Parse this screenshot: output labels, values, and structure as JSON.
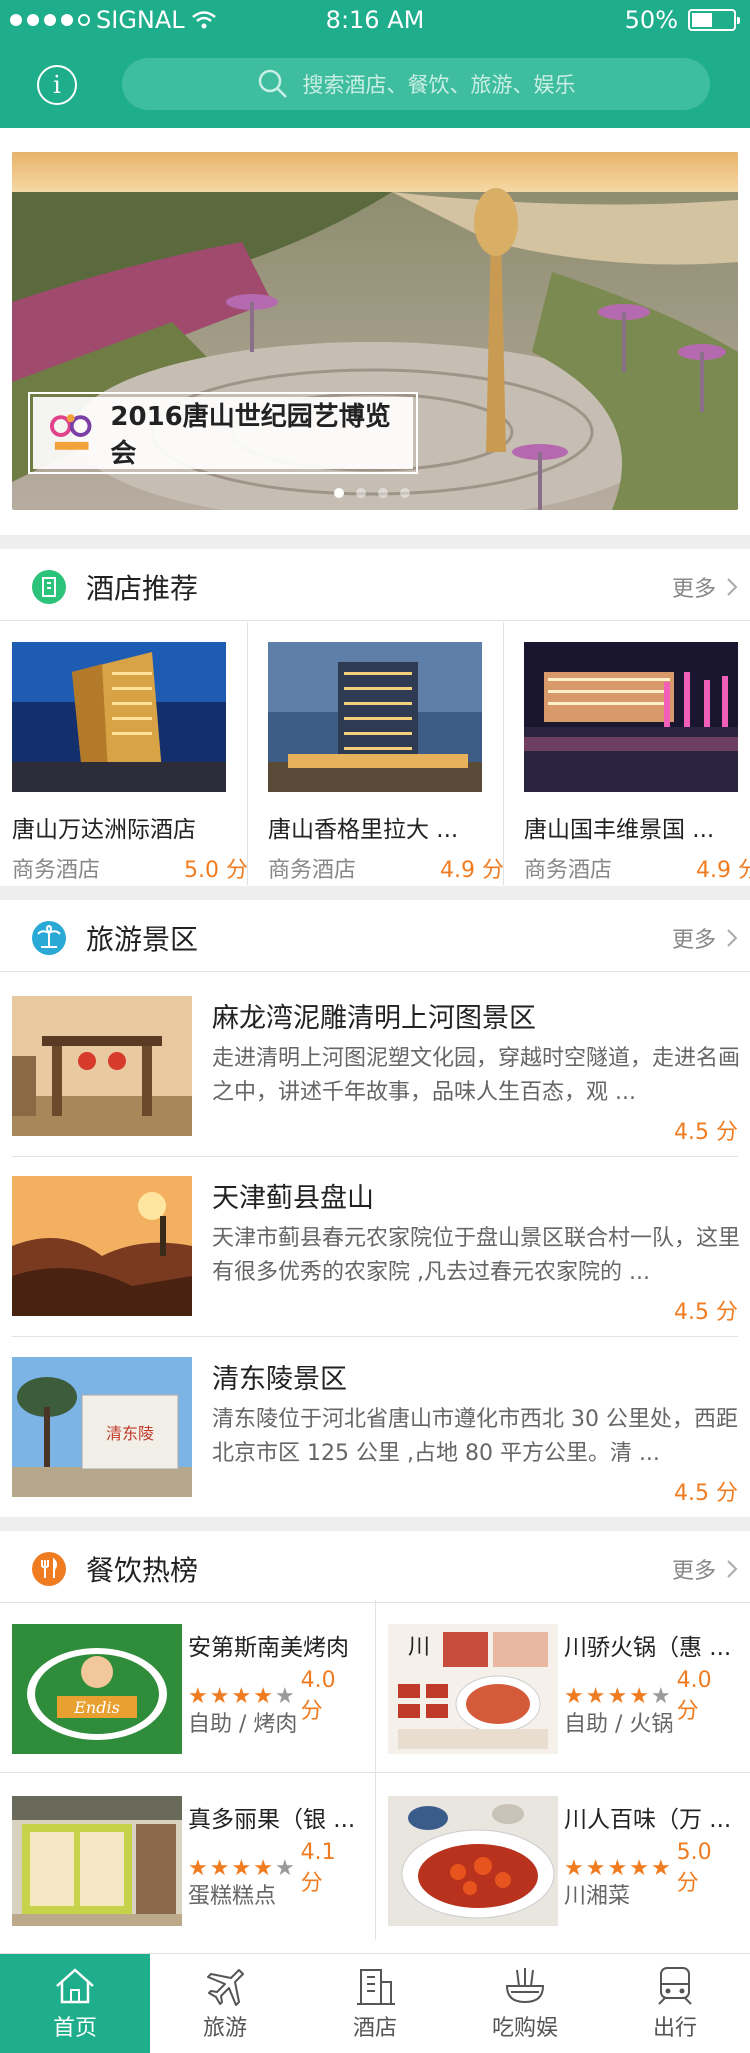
{
  "status": {
    "carrier": "SIGNAL",
    "time": "8:16 AM",
    "battery": "50%"
  },
  "header": {
    "search_placeholder": "搜索酒店、餐饮、旅游、娱乐"
  },
  "banner": {
    "caption": "2016唐山世纪园艺博览会",
    "pages": 4,
    "active_page": 0
  },
  "hotels": {
    "title": "酒店推荐",
    "more": "更多",
    "items": [
      {
        "name": "唐山万达洲际酒店",
        "type": "商务酒店",
        "score": "5.0 分"
      },
      {
        "name": "唐山香格里拉大 ...",
        "type": "商务酒店",
        "score": "4.9 分"
      },
      {
        "name": "唐山国丰维景国 ...",
        "type": "商务酒店",
        "score": "4.9 分"
      }
    ]
  },
  "tourism": {
    "title": "旅游景区",
    "more": "更多",
    "items": [
      {
        "name": "麻龙湾泥雕清明上河图景区",
        "desc": "走进清明上河图泥塑文化园，穿越时空隧道，走进名画之中，讲述千年故事，品味人生百态，观 ...",
        "score": "4.5 分"
      },
      {
        "name": "天津蓟县盘山",
        "desc": "天津市蓟县春元农家院位于盘山景区联合村一队，这里有很多优秀的农家院 ,凡去过春元农家院的 ...",
        "score": "4.5 分"
      },
      {
        "name": "清东陵景区",
        "desc": "清东陵位于河北省唐山市遵化市西北 30 公里处，西距北京市区 125 公里 ,占地 80 平方公里。清 ...",
        "score": "4.5 分"
      }
    ]
  },
  "food": {
    "title": "餐饮热榜",
    "more": "更多",
    "items": [
      {
        "name": "安第斯南美烤肉",
        "rating": 4.0,
        "score": "4.0 分",
        "category": "自助 / 烤肉"
      },
      {
        "name": "川骄火锅（惠 ...",
        "rating": 4.0,
        "score": "4.0 分",
        "category": "自助 / 火锅"
      },
      {
        "name": "真多丽果（银 ...",
        "rating": 4.1,
        "score": "4.1 分",
        "category": "蛋糕糕点"
      },
      {
        "name": "川人百味（万 ...",
        "rating": 5.0,
        "score": "5.0 分",
        "category": "川湘菜"
      }
    ]
  },
  "tabbar": {
    "items": [
      {
        "label": "首页",
        "icon": "home-icon",
        "active": true
      },
      {
        "label": "旅游",
        "icon": "plane-icon",
        "active": false
      },
      {
        "label": "酒店",
        "icon": "building-icon",
        "active": false
      },
      {
        "label": "吃购娱",
        "icon": "bowl-icon",
        "active": false
      },
      {
        "label": "出行",
        "icon": "train-icon",
        "active": false
      }
    ]
  },
  "colors": {
    "brand": "#1fae8c",
    "accent": "#f07c22"
  }
}
